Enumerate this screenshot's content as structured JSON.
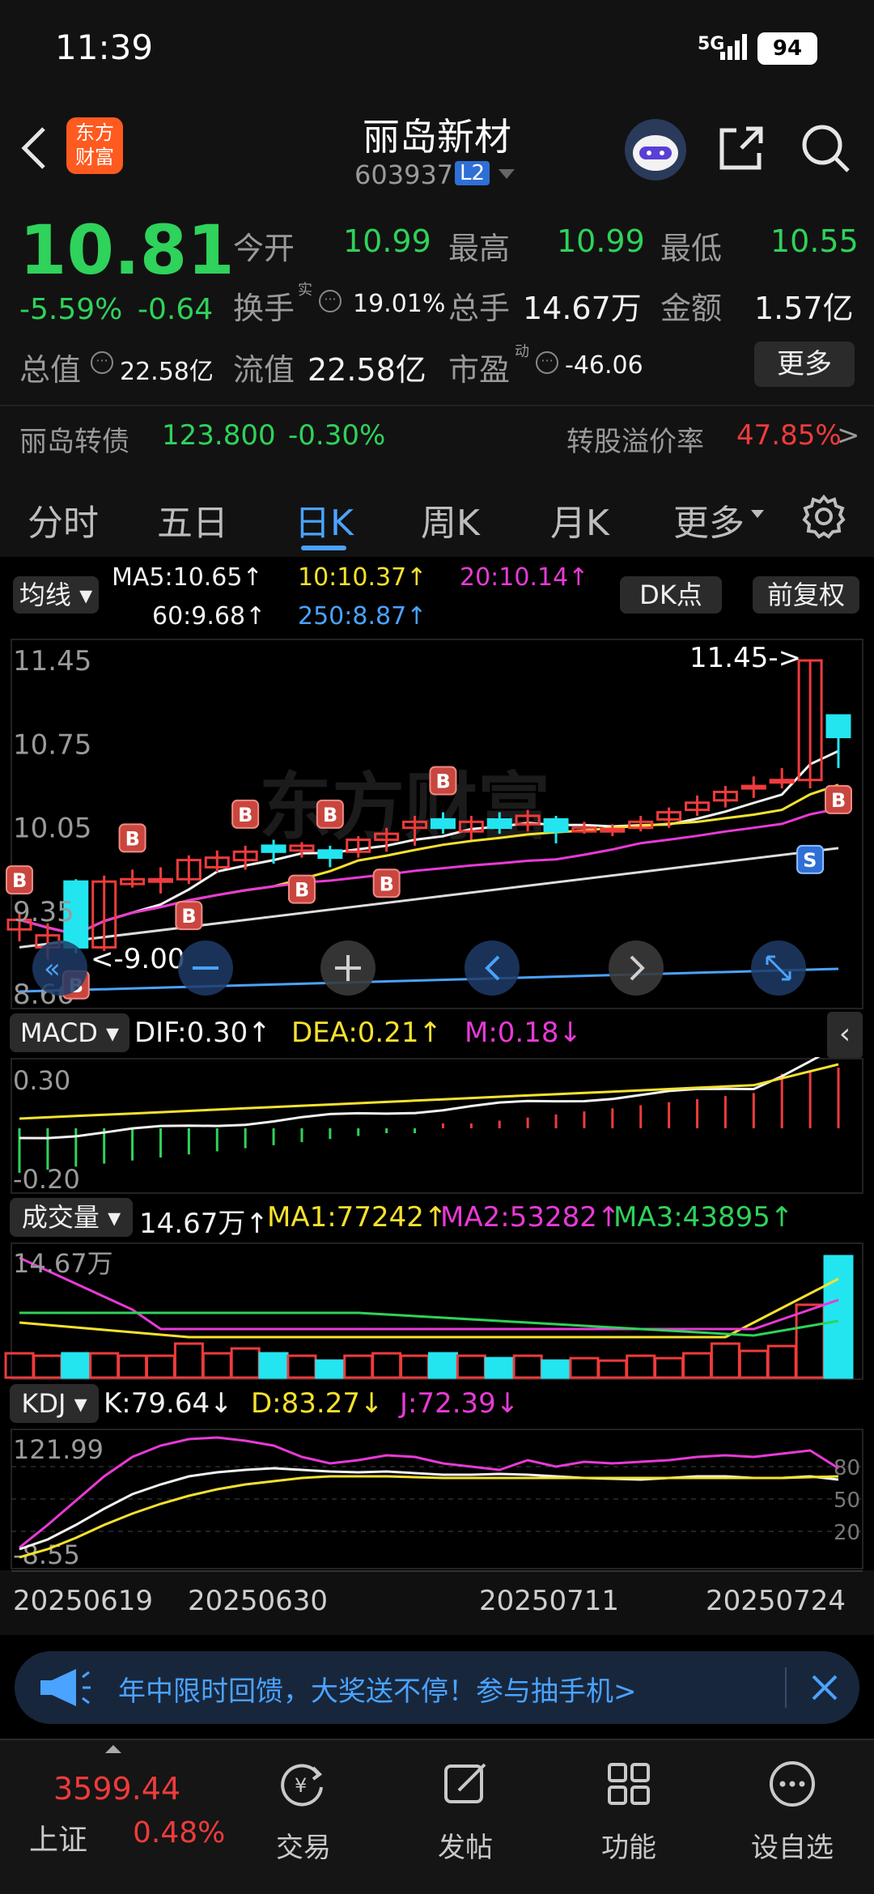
{
  "status_bar": {
    "time": "11:39",
    "network": "5G",
    "battery": "94"
  },
  "header": {
    "title": "丽岛新材",
    "code": "603937",
    "level_badge": "L2",
    "logo_text_1": "东方",
    "logo_text_2": "财富"
  },
  "quote": {
    "price": "10.81",
    "change_pct": "-5.59%",
    "change_amt": "-0.64",
    "open_label": "今开",
    "open": "10.99",
    "high_label": "最高",
    "high": "10.99",
    "low_label": "最低",
    "low": "10.55",
    "turnover_label": "换手",
    "turnover_sup": "实",
    "turnover": "19.01%",
    "volume_label": "总手",
    "volume": "14.67万",
    "amount_label": "金额",
    "amount": "1.57亿",
    "mktcap_label": "总值",
    "mktcap": "22.58亿",
    "float_label": "流值",
    "float_cap": "22.58亿",
    "pe_label": "市盈",
    "pe_sup": "动",
    "pe": "-46.06",
    "more_button": "更多",
    "bond_name": "丽岛转债",
    "bond_price": "123.800",
    "bond_change": "-0.30%",
    "premium_label": "转股溢价率",
    "premium": "47.85%"
  },
  "tabs": [
    "分时",
    "五日",
    "日K",
    "周K",
    "月K",
    "更多"
  ],
  "active_tab": "日K",
  "ma_panel": {
    "selector": "均线",
    "ma5": "MA5:10.65↑",
    "ma10": "10:10.37↑",
    "ma20": "20:10.14↑",
    "ma60": "60:9.68↑",
    "ma250": "250:8.87↑",
    "dk_button": "DK点",
    "adjust_button": "前复权"
  },
  "kline": {
    "y_labels": [
      "11.45",
      "10.75",
      "10.05",
      "9.35",
      "8.66"
    ],
    "max_annotation": "11.45->",
    "min_annotation": "<-9.00",
    "buy_marker": "B",
    "sell_marker": "S"
  },
  "macd": {
    "selector": "MACD",
    "dif": "DIF:0.30↑",
    "dea": "DEA:0.21↑",
    "m": "M:0.18↓",
    "y_top": "0.30",
    "y_bottom": "-0.20"
  },
  "volume": {
    "selector": "成交量",
    "vol": "14.67万↑",
    "ma1": "MA1:77242↑",
    "ma2": "MA2:53282↑",
    "ma3": "MA3:43895↑",
    "y_top": "14.67万"
  },
  "kdj": {
    "selector": "KDJ",
    "k": "K:79.64↓",
    "d": "D:83.27↓",
    "j": "J:72.39↓",
    "y_top": "121.99",
    "y_bottom": "-8.55",
    "levels": [
      "80",
      "50",
      "20"
    ]
  },
  "dates": [
    "20250619",
    "20250630",
    "20250711",
    "20250724"
  ],
  "banner": {
    "text": "年中限时回馈，大奖送不停！参与抽手机>"
  },
  "bottom_nav": {
    "index_price": "3599.44",
    "index_name": "上证",
    "index_change": "0.48%",
    "items": [
      "交易",
      "发帖",
      "功能",
      "设自选"
    ]
  },
  "colors": {
    "up": "#ef3b3b",
    "down": "#2fd25a",
    "bg": "#000000",
    "accent": "#4aa3ff"
  },
  "chart_data": {
    "type": "candlestick",
    "candles": [
      {
        "o": 9.2,
        "c": 9.28,
        "h": 9.35,
        "l": 9.1
      },
      {
        "o": 9.05,
        "c": 9.15,
        "h": 9.25,
        "l": 8.95
      },
      {
        "o": 9.6,
        "c": 9.05,
        "h": 9.62,
        "l": 9.0
      },
      {
        "o": 9.05,
        "c": 9.6,
        "h": 9.65,
        "l": 9.02
      },
      {
        "o": 9.58,
        "c": 9.62,
        "h": 9.7,
        "l": 9.55
      },
      {
        "o": 9.6,
        "c": 9.62,
        "h": 9.72,
        "l": 9.5
      },
      {
        "o": 9.62,
        "c": 9.78,
        "h": 9.82,
        "l": 9.58
      },
      {
        "o": 9.72,
        "c": 9.8,
        "h": 9.86,
        "l": 9.68
      },
      {
        "o": 9.78,
        "c": 9.85,
        "h": 9.9,
        "l": 9.7
      },
      {
        "o": 9.9,
        "c": 9.85,
        "h": 9.95,
        "l": 9.75
      },
      {
        "o": 9.86,
        "c": 9.9,
        "h": 9.93,
        "l": 9.8
      },
      {
        "o": 9.86,
        "c": 9.8,
        "h": 9.9,
        "l": 9.72
      },
      {
        "o": 9.85,
        "c": 9.95,
        "h": 9.98,
        "l": 9.8
      },
      {
        "o": 9.95,
        "c": 10.0,
        "h": 10.05,
        "l": 9.85
      },
      {
        "o": 10.05,
        "c": 10.1,
        "h": 10.15,
        "l": 9.9
      },
      {
        "o": 10.12,
        "c": 10.05,
        "h": 10.18,
        "l": 10.0
      },
      {
        "o": 10.02,
        "c": 10.1,
        "h": 10.15,
        "l": 9.95
      },
      {
        "o": 10.12,
        "c": 10.05,
        "h": 10.18,
        "l": 10.0
      },
      {
        "o": 10.08,
        "c": 10.15,
        "h": 10.2,
        "l": 10.02
      },
      {
        "o": 10.12,
        "c": 10.02,
        "h": 10.15,
        "l": 9.92
      },
      {
        "o": 10.02,
        "c": 10.05,
        "h": 10.1,
        "l": 10.0
      },
      {
        "o": 10.02,
        "c": 10.04,
        "h": 10.08,
        "l": 9.98
      },
      {
        "o": 10.05,
        "c": 10.1,
        "h": 10.15,
        "l": 10.02
      },
      {
        "o": 10.12,
        "c": 10.18,
        "h": 10.22,
        "l": 10.05
      },
      {
        "o": 10.2,
        "c": 10.26,
        "h": 10.32,
        "l": 10.15
      },
      {
        "o": 10.28,
        "c": 10.35,
        "h": 10.4,
        "l": 10.22
      },
      {
        "o": 10.38,
        "c": 10.4,
        "h": 10.48,
        "l": 10.3
      },
      {
        "o": 10.45,
        "c": 10.45,
        "h": 10.55,
        "l": 10.38
      },
      {
        "o": 10.45,
        "c": 11.45,
        "h": 11.45,
        "l": 10.38
      },
      {
        "o": 10.99,
        "c": 10.81,
        "h": 10.99,
        "l": 10.55
      }
    ]
  }
}
